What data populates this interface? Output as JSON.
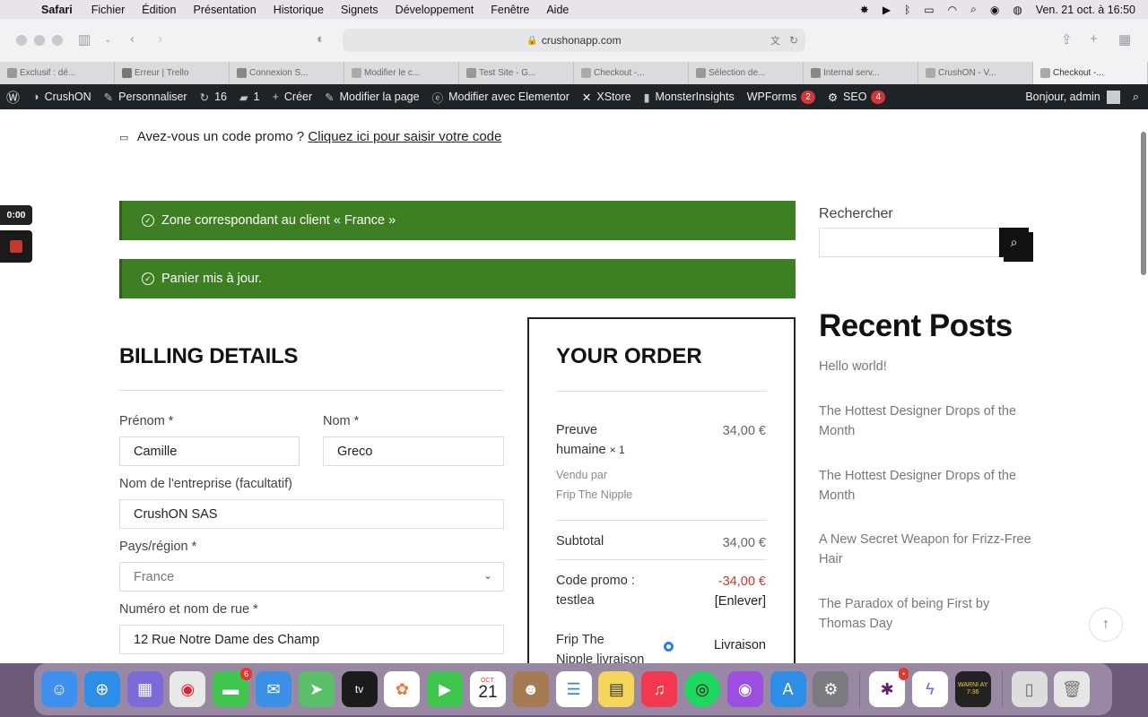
{
  "menubar": {
    "app": "Safari",
    "items": [
      "Fichier",
      "Édition",
      "Présentation",
      "Historique",
      "Signets",
      "Développement",
      "Fenêtre",
      "Aide"
    ],
    "datetime": "Ven. 21 oct. à 16:50"
  },
  "browser": {
    "url": "crushonapp.com",
    "tabs": [
      {
        "label": "Exclusif : dé..."
      },
      {
        "label": "Erreur | Trello"
      },
      {
        "label": "Connexion S..."
      },
      {
        "label": "Modifier le c..."
      },
      {
        "label": "Test Site - G..."
      },
      {
        "label": "Checkout -..."
      },
      {
        "label": "Sélection de..."
      },
      {
        "label": "Internal serv..."
      },
      {
        "label": "CrushON - V..."
      },
      {
        "label": "Checkout -..."
      }
    ]
  },
  "wpbar": {
    "site": "CrushON",
    "customize": "Personnaliser",
    "updates": "16",
    "comments": "1",
    "create": "Créer",
    "edit_page": "Modifier la page",
    "elementor": "Modifier avec Elementor",
    "xstore": "XStore",
    "monsterinsights": "MonsterInsights",
    "wpforms": "WPForms",
    "wpforms_count": "2",
    "seo": "SEO",
    "seo_count": "4",
    "greeting": "Bonjour, admin"
  },
  "recording": {
    "time": "0:00"
  },
  "checkout": {
    "promo_text": "Avez-vous un code promo ?",
    "promo_link": "Cliquez ici pour saisir votre code",
    "notice_zone": "Zone correspondant au client « France »",
    "notice_cart": "Panier mis à jour.",
    "billing": {
      "title": "BILLING DETAILS",
      "firstname_label": "Prénom *",
      "firstname_value": "Camille",
      "lastname_label": "Nom *",
      "lastname_value": "Greco",
      "company_label": "Nom de l'entreprise (facultatif)",
      "company_value": "CrushON SAS",
      "country_label": "Pays/région *",
      "country_value": "France",
      "street_label": "Numéro et nom de rue *",
      "street_value": "12 Rue Notre Dame des Champ"
    },
    "order": {
      "title": "YOUR ORDER",
      "product_name_1": "Preuve",
      "product_name_2": "humaine",
      "product_qty": "× 1",
      "product_price": "34,00 €",
      "sold_by": "Vendu par",
      "vendor": "Frip The Nipple",
      "subtotal_label": "Subtotal",
      "subtotal_value": "34,00 €",
      "coupon_label": "Code promo :",
      "coupon_code": "testlea",
      "coupon_value": "-34,00 €",
      "coupon_remove": "[Enlever]",
      "shipping_label_1": "Frip The",
      "shipping_label_2": "Nipple livraison",
      "shipping_option": "Livraison"
    }
  },
  "sidebar": {
    "search_label": "Rechercher",
    "recent_title": "Recent Posts",
    "posts": [
      "Hello world!",
      "The Hottest Designer Drops of the Month",
      "The Hottest Designer Drops of the Month",
      "A New Secret Weapon for Frizz-Free Hair",
      "The Paradox of being First by Thomas Day"
    ]
  },
  "dock": {
    "messages_badge": "6",
    "calendar_month": "OCT.",
    "calendar_day": "21",
    "slack_badge": "•",
    "console_text": "WARNI AY 7:36"
  }
}
